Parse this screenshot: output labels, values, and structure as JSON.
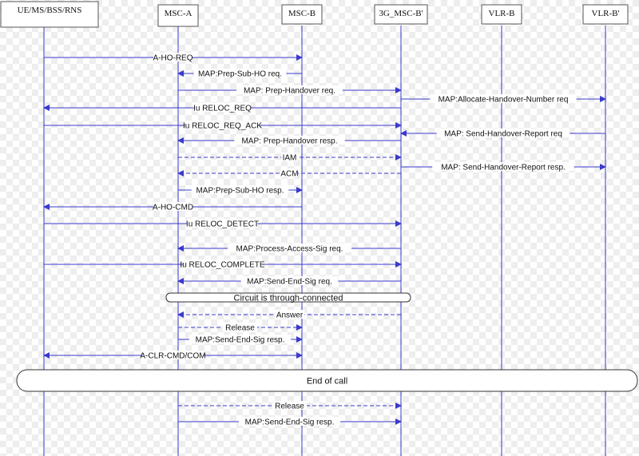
{
  "colors": {
    "line": "#3a3acc",
    "bar_fill": "#ffffff",
    "bar_stroke": "#333333",
    "box_stroke": "#555555"
  },
  "entities": [
    {
      "id": "ue",
      "label": "UE/MS/BSS/RNS"
    },
    {
      "id": "msca",
      "label": "MSC-A"
    },
    {
      "id": "mscb",
      "label": "MSC-B"
    },
    {
      "id": "msc3g",
      "label": "3G_MSC-B'"
    },
    {
      "id": "vlrb",
      "label": "VLR-B"
    },
    {
      "id": "vlrb2",
      "label": "VLR-B'"
    }
  ],
  "messages": [
    {
      "label": "A-HO-REQ",
      "from": "ue",
      "to": "mscb",
      "style": "solid"
    },
    {
      "label": "MAP:Prep-Sub-HO req.",
      "from": "mscb",
      "to": "msca",
      "style": "solid"
    },
    {
      "label": "MAP: Prep-Handover req.",
      "from": "msca",
      "to": "msc3g",
      "style": "solid"
    },
    {
      "label": "MAP:Allocate-Handover-Number req",
      "from": "msc3g",
      "to": "vlrb2",
      "style": "solid"
    },
    {
      "label": "Iu RELOC_REQ",
      "from": "msc3g",
      "to": "ue",
      "style": "solid"
    },
    {
      "label": "Iu RELOC_REQ_ACK",
      "from": "ue",
      "to": "msc3g",
      "style": "solid"
    },
    {
      "label": "MAP: Send-Handover-Report req",
      "from": "vlrb2",
      "to": "msc3g",
      "style": "solid"
    },
    {
      "label": "MAP: Prep-Handover resp.",
      "from": "msc3g",
      "to": "msca",
      "style": "solid"
    },
    {
      "label": "IAM",
      "from": "msca",
      "to": "msc3g",
      "style": "dashed"
    },
    {
      "label": "MAP: Send-Handover-Report resp.",
      "from": "msc3g",
      "to": "vlrb2",
      "style": "solid"
    },
    {
      "label": "ACM",
      "from": "msc3g",
      "to": "msca",
      "style": "dashed"
    },
    {
      "label": "MAP:Prep-Sub-HO resp.",
      "from": "msca",
      "to": "mscb",
      "style": "solid"
    },
    {
      "label": "A-HO-CMD",
      "from": "mscb",
      "to": "ue",
      "style": "solid"
    },
    {
      "label": "Iu RELOC_DETECT",
      "from": "ue",
      "to": "msc3g",
      "style": "solid"
    },
    {
      "label": "MAP:Process-Access-Sig req.",
      "from": "msc3g",
      "to": "msca",
      "style": "solid"
    },
    {
      "label": "Iu RELOC_COMPLETE",
      "from": "ue",
      "to": "msc3g",
      "style": "solid"
    },
    {
      "label": "MAP:Send-End-Sig req.",
      "from": "msc3g",
      "to": "msca",
      "style": "solid"
    },
    {
      "label": "Answer",
      "from": "msc3g",
      "to": "msca",
      "style": "dashed"
    },
    {
      "label": "Release",
      "from": "msca",
      "to": "mscb",
      "style": "dashed"
    },
    {
      "label": "MAP:Send-End-Sig resp.",
      "from": "msca",
      "to": "mscb",
      "style": "solid"
    },
    {
      "label": "A-CLR-CMD/COM",
      "from": "ue",
      "to": "mscb",
      "style": "both"
    },
    {
      "label": "Release",
      "from": "msca",
      "to": "msc3g",
      "style": "dashed"
    },
    {
      "label": "MAP:Send-End-Sig resp.",
      "from": "msca",
      "to": "msc3g",
      "style": "solid"
    }
  ],
  "bars": [
    {
      "label": "Circuit is through-connected",
      "span": [
        "msca",
        "msc3g"
      ]
    },
    {
      "label": "End of call",
      "span": [
        "all"
      ]
    }
  ]
}
